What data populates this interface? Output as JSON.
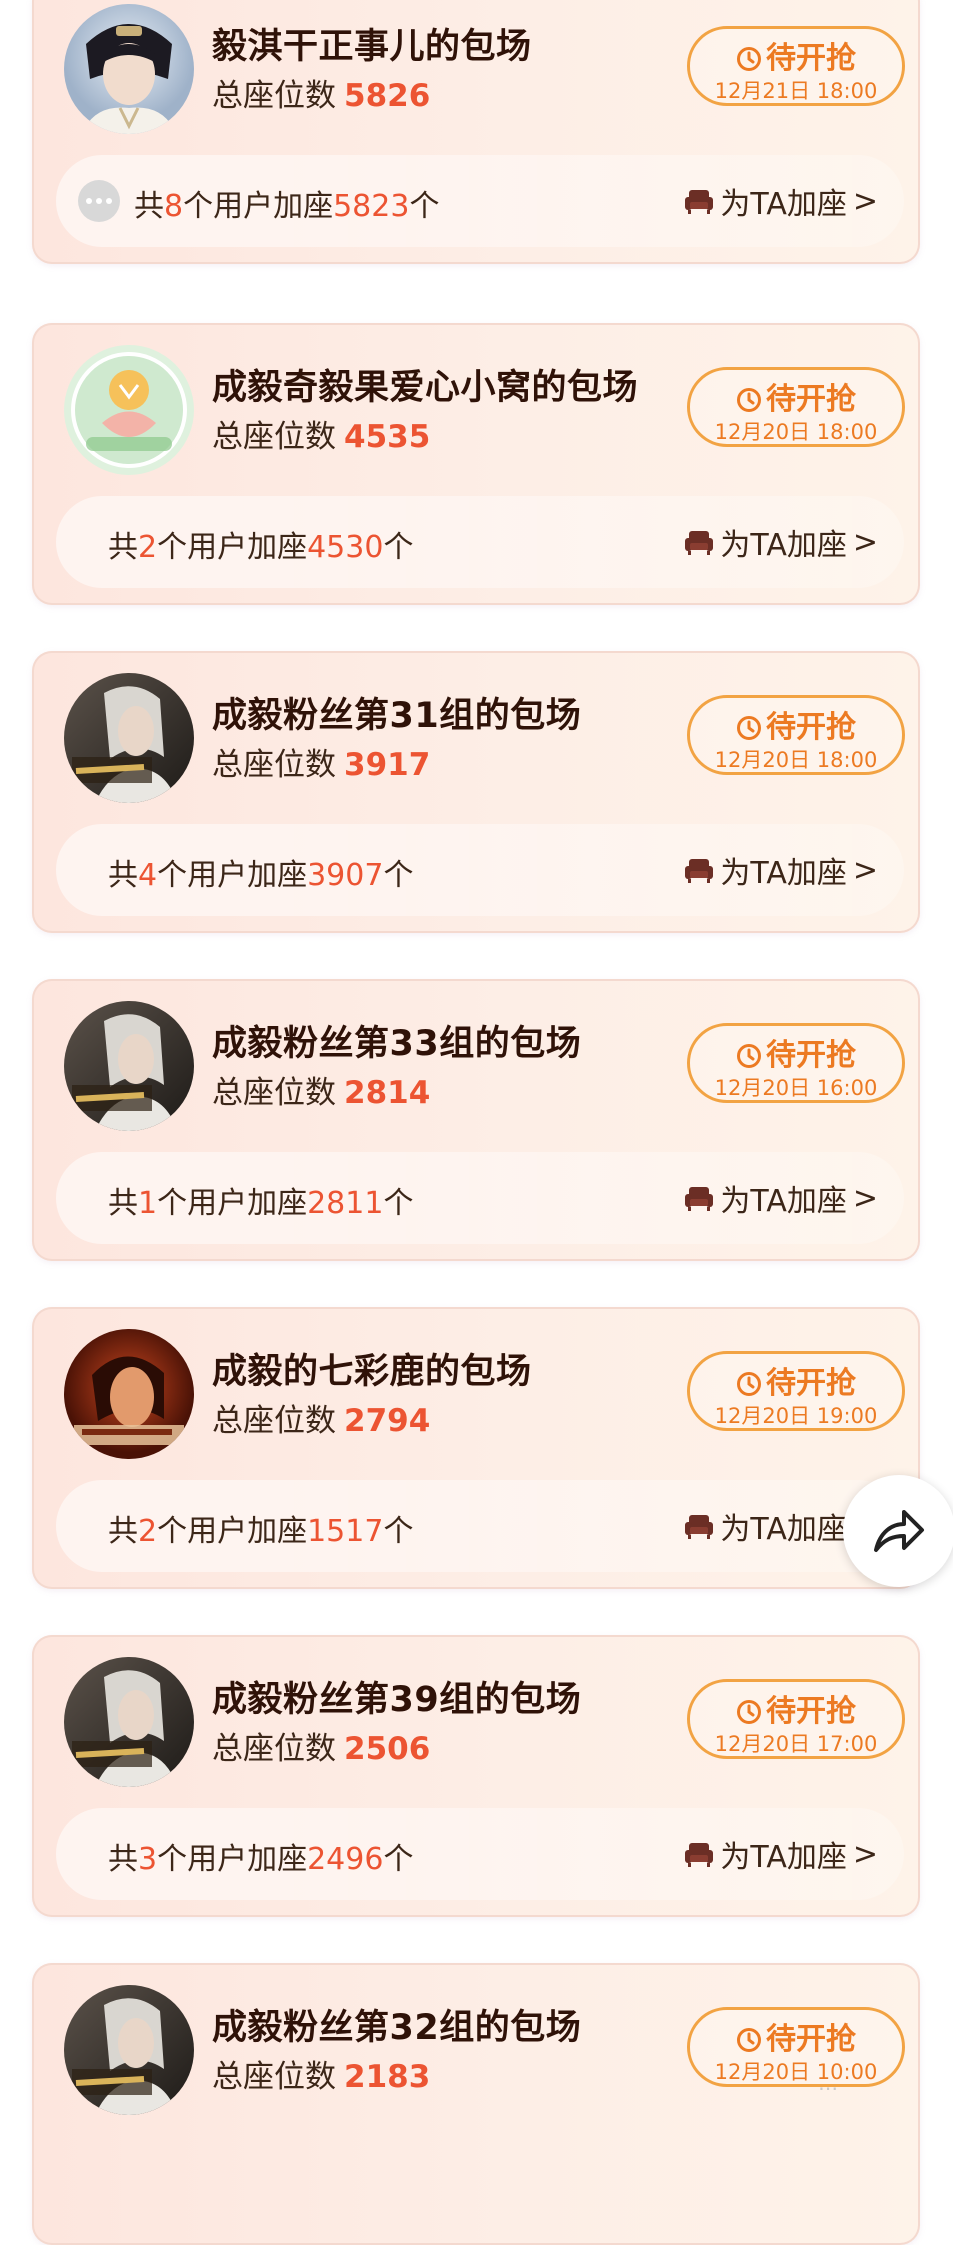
{
  "seat_count_label": "总座位数",
  "summary_labels": {
    "prefix": "共",
    "middle": "个用户加座",
    "suffix": "个"
  },
  "add_seat_label": "为TA加座",
  "add_seat_arrow": ">",
  "status_label": "待开抢",
  "colors": {
    "accent_red": "#ec5432",
    "accent_orange": "#ec7a22",
    "title_brown": "#2f1208"
  },
  "icons": {
    "status": "clock-icon",
    "add_seat": "sofa-icon",
    "share": "share-arrow-icon",
    "more": "more-dots-icon"
  },
  "cards": [
    {
      "title": "毅淇干正事儿的包场",
      "seats": "5826",
      "status_time": "12月21日 18:00",
      "user_count": "8",
      "added_seats": "5823",
      "avatar": "prince",
      "show_more_icon": true
    },
    {
      "title": "成毅奇毅果爱心小窝的包场",
      "seats": "4535",
      "status_time": "12月20日 18:00",
      "user_count": "2",
      "added_seats": "4530",
      "avatar": "badge",
      "show_more_icon": false
    },
    {
      "title": "成毅粉丝第31组的包场",
      "seats": "3917",
      "status_time": "12月20日 18:00",
      "user_count": "4",
      "added_seats": "3907",
      "avatar": "poster",
      "show_more_icon": false
    },
    {
      "title": "成毅粉丝第33组的包场",
      "seats": "2814",
      "status_time": "12月20日 16:00",
      "user_count": "1",
      "added_seats": "2811",
      "avatar": "poster",
      "show_more_icon": false
    },
    {
      "title": "成毅的七彩鹿的包场",
      "seats": "2794",
      "status_time": "12月20日 19:00",
      "user_count": "2",
      "added_seats": "1517",
      "avatar": "red",
      "show_more_icon": false
    },
    {
      "title": "成毅粉丝第39组的包场",
      "seats": "2506",
      "status_time": "12月20日 17:00",
      "user_count": "3",
      "added_seats": "2496",
      "avatar": "poster",
      "show_more_icon": false
    },
    {
      "title": "成毅粉丝第32组的包场",
      "seats": "2183",
      "status_time": "12月20日 10:00",
      "user_count": "",
      "added_seats": "",
      "avatar": "poster",
      "show_more_icon": false
    }
  ]
}
